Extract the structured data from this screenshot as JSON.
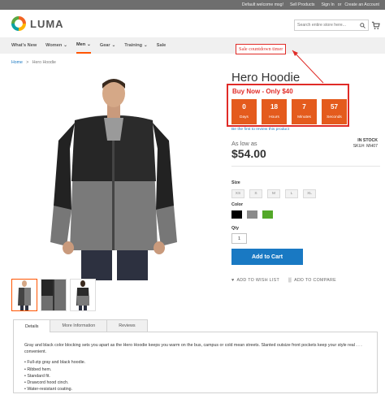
{
  "topbar": {
    "welcome": "Default welcome msg!",
    "sell_products": "Sell Products",
    "sign_in": "Sign In",
    "or": "or",
    "create_account": "Create an Account"
  },
  "header": {
    "logo_text": "LUMA",
    "search_placeholder": "Search entire store here...",
    "search_icon": "search-icon",
    "cart_icon": "cart-icon"
  },
  "nav": {
    "items": [
      {
        "label": "What's New",
        "has_dropdown": false
      },
      {
        "label": "Women",
        "has_dropdown": true
      },
      {
        "label": "Men",
        "has_dropdown": true,
        "active": true
      },
      {
        "label": "Gear",
        "has_dropdown": true
      },
      {
        "label": "Training",
        "has_dropdown": true
      },
      {
        "label": "Sale",
        "has_dropdown": false
      }
    ]
  },
  "annotation": {
    "label": "Sale countdown timer",
    "color": "#e02b27"
  },
  "breadcrumb": {
    "home": "Home",
    "separator": ">",
    "current": "Hero Hoodie"
  },
  "product": {
    "title": "Hero Hoodie",
    "review_link": "Be the first to review this product",
    "stock": "IN STOCK",
    "sku_label": "SKU#:",
    "sku": "MH07",
    "as_low_as": "As low as",
    "price": "$54.00",
    "size_label": "Size",
    "sizes": [
      "XS",
      "S",
      "M",
      "L",
      "XL"
    ],
    "color_label": "Color",
    "colors": [
      "#000000",
      "#8a8a8a",
      "#53a828"
    ],
    "qty_label": "Qty",
    "qty": "1",
    "add_to_cart": "Add to Cart",
    "wishlist": "ADD TO WISH LIST",
    "compare": "ADD TO COMPARE"
  },
  "timer": {
    "headline": "Buy Now - Only $40",
    "accent": "#e45b1d",
    "units": [
      {
        "value": "0",
        "label": "Days"
      },
      {
        "value": "18",
        "label": "Hours"
      },
      {
        "value": "7",
        "label": "Minutes"
      },
      {
        "value": "57",
        "label": "Seconds"
      }
    ]
  },
  "tabs": {
    "items": [
      {
        "label": "Details",
        "active": true
      },
      {
        "label": "More Information",
        "active": false
      },
      {
        "label": "Reviews",
        "active": false
      }
    ],
    "details_text": "Gray and black color blocking sets you apart as the Hero Hoodie keeps you warm on the bus, campus or cold mean streets. Slanted outsize front pockets keep your style real . . . convenient.",
    "bullets": [
      "• Full-zip gray and black hoodie.",
      "• Ribbed hem.",
      "• Standard fit.",
      "• Drawcord hood cinch.",
      "• Water-resistant coating."
    ]
  }
}
